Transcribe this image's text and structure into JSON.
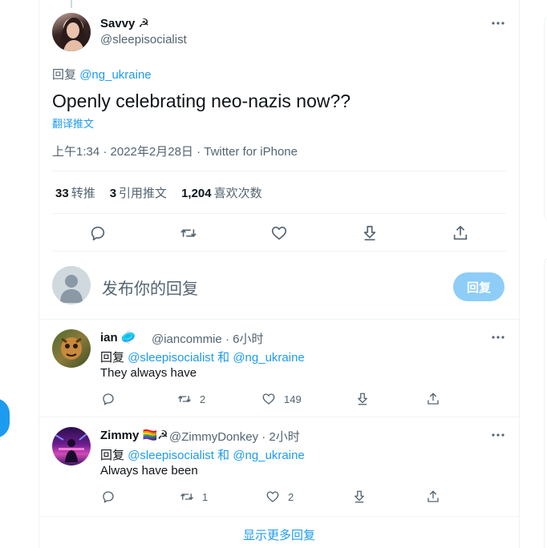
{
  "main_tweet": {
    "author_name": "Savvy",
    "author_emoji": "☭",
    "author_handle": "@sleepisocialist",
    "reply_prefix": "回复",
    "reply_to": "@ng_ukraine",
    "text": "Openly celebrating neo-nazis now??",
    "translate_label": "翻译推文",
    "timestamp": "上午1:34 · 2022年2月28日 · Twitter for iPhone",
    "stats": {
      "retweets_count": "33",
      "retweets_label": "转推",
      "quotes_count": "3",
      "quotes_label": "引用推文",
      "likes_count": "1,204",
      "likes_label": "喜欢次数"
    }
  },
  "compose": {
    "placeholder": "发布你的回复",
    "reply_button": "回复"
  },
  "replies": [
    {
      "name": "ian",
      "badge": "🥏",
      "handle": "@iancommie",
      "time": "· 6小时",
      "reply_prefix": "回复",
      "reply_to_1": "@sleepisocialist",
      "reply_and": "和",
      "reply_to_2": "@ng_ukraine",
      "text": "They always have",
      "retweets": "2",
      "likes": "149"
    },
    {
      "name": "Zimmy",
      "badge": "🏳️‍🌈☭",
      "handle": "@ZimmyDonkey",
      "time": "· 2小时",
      "reply_prefix": "回复",
      "reply_to_1": "@sleepisocialist",
      "reply_and": "和",
      "reply_to_2": "@ng_ukraine",
      "text": "Always have been",
      "retweets": "1",
      "likes": "2"
    }
  ],
  "show_more_label": "显示更多回复",
  "colors": {
    "accent": "#1d9bf0",
    "text": "#0f1419",
    "secondary": "#536471",
    "border": "#eff3f4"
  }
}
